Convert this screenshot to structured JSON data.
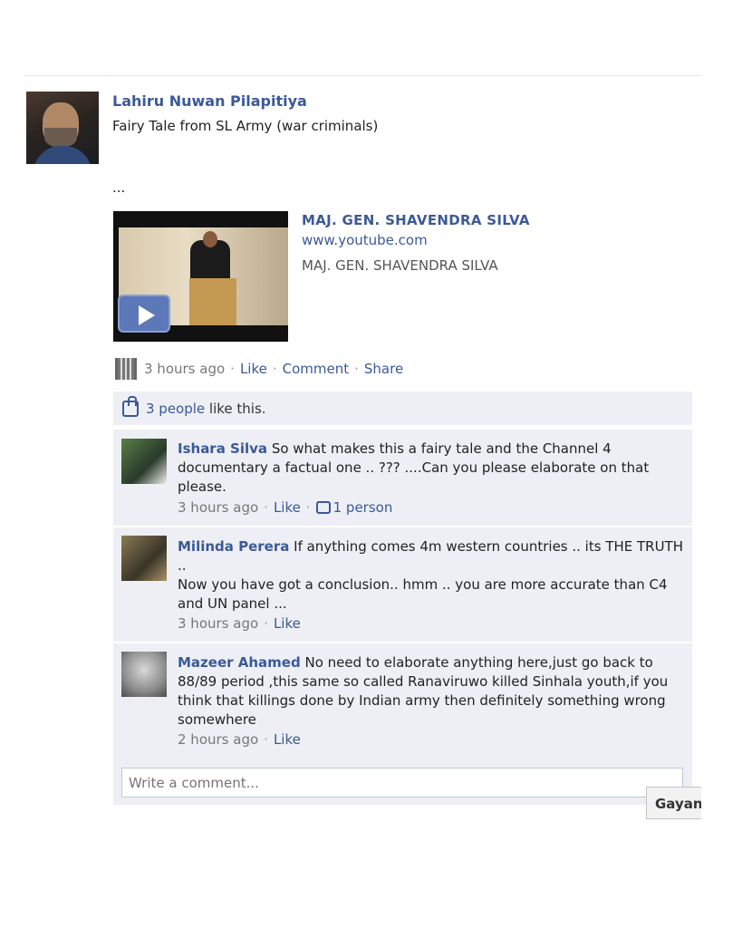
{
  "post": {
    "author": "Lahiru Nuwan Pilapitiya",
    "message": "Fairy Tale from SL Army (war criminals)",
    "ellipsis": "...",
    "attachment": {
      "title": "MAJ. GEN. SHAVENDRA SILVA",
      "url": "www.youtube.com",
      "description": "MAJ. GEN. SHAVENDRA SILVA"
    },
    "meta": {
      "time": "3 hours ago",
      "like": "Like",
      "comment": "Comment",
      "share": "Share",
      "separator": "·"
    }
  },
  "likes": {
    "people_link": "3 people",
    "suffix": " like this."
  },
  "comments": [
    {
      "name": "Ishara Silva",
      "text": " So what makes this a fairy tale and the Channel 4 documentary a factual one .. ??? ....Can you please elaborate on that please.",
      "time": "3 hours ago",
      "like": "Like",
      "likes_count": "1 person"
    },
    {
      "name": "Milinda Perera",
      "text": " If anything comes 4m western countries .. its THE TRUTH ..",
      "text2": "Now you have got a conclusion.. hmm .. you are more accurate than C4 and UN panel ...",
      "time": "3 hours ago",
      "like": "Like"
    },
    {
      "name": "Mazeer Ahamed",
      "text": " No need to elaborate anything here,just go back to 88/89 period ,this same so called Ranaviruwo killed Sinhala youth,if you think that killings done by Indian army then definitely something wrong somewhere",
      "time": "2 hours ago",
      "like": "Like"
    }
  ],
  "write_comment": {
    "placeholder": "Write a comment..."
  },
  "chat_tab": {
    "label": "Gayan"
  }
}
